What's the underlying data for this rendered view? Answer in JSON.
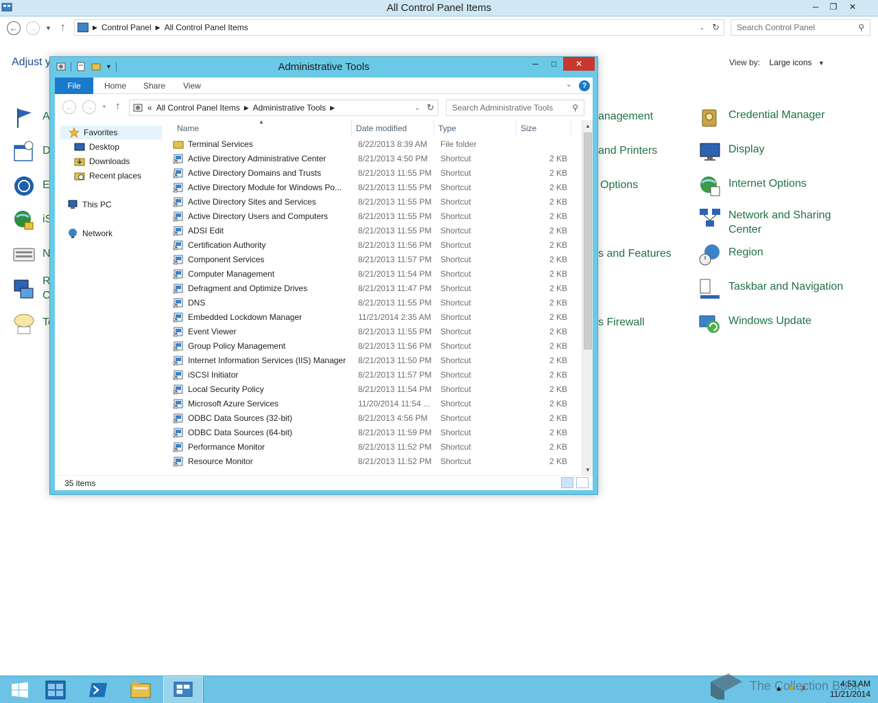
{
  "control_panel": {
    "window_title": "All Control Panel Items",
    "breadcrumb": [
      "Control Panel",
      "All Control Panel Items"
    ],
    "search_placeholder": "Search Control Panel",
    "heading_partial": "Adjust y",
    "view_by_label": "View by:",
    "view_by_value": "Large icons",
    "left_partial_labels": [
      "A",
      "D",
      "Ea",
      "iS",
      "N",
      "R",
      "C",
      "Te"
    ],
    "middle_partial_labels": [
      "anagement",
      "and Printers",
      "Options",
      "s and Features",
      "s Firewall"
    ],
    "right_items": [
      {
        "label": "Credential Manager",
        "icon": "credential-manager-icon"
      },
      {
        "label": "Display",
        "icon": "display-icon"
      },
      {
        "label": "Internet Options",
        "icon": "internet-options-icon"
      },
      {
        "label": "Network and Sharing Center",
        "icon": "network-sharing-icon"
      },
      {
        "label": "Region",
        "icon": "region-icon"
      },
      {
        "label": "Taskbar and Navigation",
        "icon": "taskbar-icon"
      },
      {
        "label": "Windows Update",
        "icon": "windows-update-icon"
      }
    ]
  },
  "admin_tools": {
    "window_title": "Administrative Tools",
    "ribbon_tabs": [
      "File",
      "Home",
      "Share",
      "View"
    ],
    "help_glyph": "?",
    "breadcrumb": [
      "All Control Panel Items",
      "Administrative Tools"
    ],
    "breadcrumb_overflow": "«",
    "search_placeholder": "Search Administrative Tools",
    "nav": {
      "favorites": "Favorites",
      "desktop": "Desktop",
      "downloads": "Downloads",
      "recent": "Recent places",
      "this_pc": "This PC",
      "network": "Network"
    },
    "columns": {
      "name": "Name",
      "date": "Date modified",
      "type": "Type",
      "size": "Size"
    },
    "files": [
      {
        "name": "Terminal Services",
        "date": "8/22/2013 8:39 AM",
        "type": "File folder",
        "size": "",
        "icon": "folder"
      },
      {
        "name": "Active Directory Administrative Center",
        "date": "8/21/2013 4:50 PM",
        "type": "Shortcut",
        "size": "2 KB",
        "icon": "shortcut"
      },
      {
        "name": "Active Directory Domains and Trusts",
        "date": "8/21/2013 11:55 PM",
        "type": "Shortcut",
        "size": "2 KB",
        "icon": "shortcut"
      },
      {
        "name": "Active Directory Module for Windows Po...",
        "date": "8/21/2013 11:55 PM",
        "type": "Shortcut",
        "size": "2 KB",
        "icon": "shortcut"
      },
      {
        "name": "Active Directory Sites and Services",
        "date": "8/21/2013 11:55 PM",
        "type": "Shortcut",
        "size": "2 KB",
        "icon": "shortcut"
      },
      {
        "name": "Active Directory Users and Computers",
        "date": "8/21/2013 11:55 PM",
        "type": "Shortcut",
        "size": "2 KB",
        "icon": "shortcut"
      },
      {
        "name": "ADSI Edit",
        "date": "8/21/2013 11:55 PM",
        "type": "Shortcut",
        "size": "2 KB",
        "icon": "shortcut"
      },
      {
        "name": "Certification Authority",
        "date": "8/21/2013 11:56 PM",
        "type": "Shortcut",
        "size": "2 KB",
        "icon": "shortcut"
      },
      {
        "name": "Component Services",
        "date": "8/21/2013 11:57 PM",
        "type": "Shortcut",
        "size": "2 KB",
        "icon": "shortcut"
      },
      {
        "name": "Computer Management",
        "date": "8/21/2013 11:54 PM",
        "type": "Shortcut",
        "size": "2 KB",
        "icon": "shortcut"
      },
      {
        "name": "Defragment and Optimize Drives",
        "date": "8/21/2013 11:47 PM",
        "type": "Shortcut",
        "size": "2 KB",
        "icon": "shortcut"
      },
      {
        "name": "DNS",
        "date": "8/21/2013 11:55 PM",
        "type": "Shortcut",
        "size": "2 KB",
        "icon": "shortcut"
      },
      {
        "name": "Embedded Lockdown Manager",
        "date": "11/21/2014 2:35 AM",
        "type": "Shortcut",
        "size": "2 KB",
        "icon": "shortcut"
      },
      {
        "name": "Event Viewer",
        "date": "8/21/2013 11:55 PM",
        "type": "Shortcut",
        "size": "2 KB",
        "icon": "shortcut"
      },
      {
        "name": "Group Policy Management",
        "date": "8/21/2013 11:56 PM",
        "type": "Shortcut",
        "size": "2 KB",
        "icon": "shortcut"
      },
      {
        "name": "Internet Information Services (IIS) Manager",
        "date": "8/21/2013 11:50 PM",
        "type": "Shortcut",
        "size": "2 KB",
        "icon": "shortcut"
      },
      {
        "name": "iSCSI Initiator",
        "date": "8/21/2013 11:57 PM",
        "type": "Shortcut",
        "size": "2 KB",
        "icon": "shortcut"
      },
      {
        "name": "Local Security Policy",
        "date": "8/21/2013 11:54 PM",
        "type": "Shortcut",
        "size": "2 KB",
        "icon": "shortcut"
      },
      {
        "name": "Microsoft Azure Services",
        "date": "11/20/2014 11:54 ...",
        "type": "Shortcut",
        "size": "2 KB",
        "icon": "shortcut"
      },
      {
        "name": "ODBC Data Sources (32-bit)",
        "date": "8/21/2013 4:56 PM",
        "type": "Shortcut",
        "size": "2 KB",
        "icon": "shortcut"
      },
      {
        "name": "ODBC Data Sources (64-bit)",
        "date": "8/21/2013 11:59 PM",
        "type": "Shortcut",
        "size": "2 KB",
        "icon": "shortcut"
      },
      {
        "name": "Performance Monitor",
        "date": "8/21/2013 11:52 PM",
        "type": "Shortcut",
        "size": "2 KB",
        "icon": "shortcut"
      },
      {
        "name": "Resource Monitor",
        "date": "8/21/2013 11:52 PM",
        "type": "Shortcut",
        "size": "2 KB",
        "icon": "shortcut"
      }
    ],
    "status_count": "35 items"
  },
  "taskbar": {
    "time": "4:53 AM",
    "date": "11/21/2014",
    "watermark": "The Collection Book"
  },
  "colors": {
    "accent": "#1979ca",
    "window_frame": "#6bc9e8",
    "taskbar": "#6cc3e6",
    "cp_link": "#1e7145",
    "close_red": "#c7382e"
  }
}
